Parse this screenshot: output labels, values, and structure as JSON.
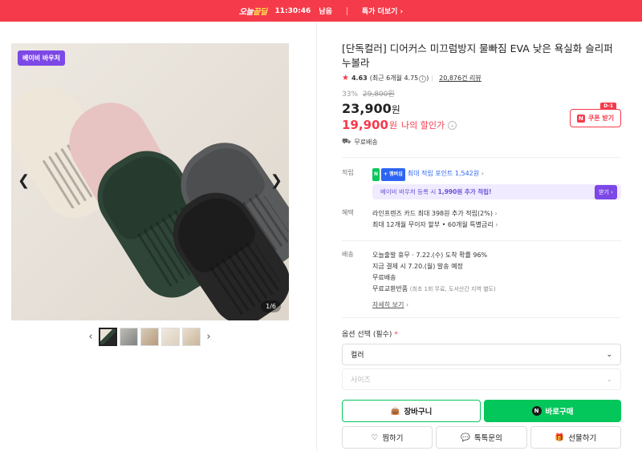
{
  "top_banner": {
    "brand_prefix": "오늘",
    "brand_highlight": "끝딜",
    "countdown": "11:30:46",
    "countdown_suffix": "남음",
    "more_label": "특가 더보기",
    "bg_color": "#f53b4b"
  },
  "gallery": {
    "badge": "베이비 바우처",
    "counter": "1/6",
    "prev_icon": "chevron-left-icon",
    "next_icon": "chevron-right-icon",
    "slipper_colors": [
      "#eee6d8",
      "#e8c4c3",
      "#2f4538",
      "#5a5b5c",
      "#262626"
    ],
    "thumb_count": 5
  },
  "product": {
    "title": "[단독컬러] 디어커스 미끄럼방지 물빠짐 EVA 낮은 욕실화 슬리퍼 누볼라",
    "rating": "4.63",
    "rating_detail": "(최근 6개월 4.75",
    "rating_detail_end": ")",
    "reviews": "20,876건 리뷰",
    "discount": "33%",
    "original_price": "29,800원",
    "price": "23,900",
    "price_unit": "원",
    "my_price": "19,900",
    "my_price_unit": "원",
    "my_price_label": "나의 할인가",
    "coupon_label": "쿠폰 받기",
    "coupon_badge": "D-1",
    "shipping": "무료배송"
  },
  "points": {
    "key": "적립",
    "badge_n": "N",
    "badge_pay": "+ 멤버십",
    "text": "최대 적립 포인트 1,542원",
    "voucher_text_pre": "베이비 바우처 등록 시 ",
    "voucher_amount": "1,990원 추가 적립!",
    "voucher_button": "받기"
  },
  "benefits": {
    "key": "혜택",
    "line1": "라인프렌즈 카드 최대 398원 추가 적립(2%)",
    "line2": "최대 12개월 무이자 할부 • 60개월 특별금리"
  },
  "delivery": {
    "key": "배송",
    "line1": "오늘출발 휴무 · 7.22.(수) 도착 확률 96%",
    "line2": "지금 결제 시 7.20.(월) 발송 예정",
    "line3": "무료배송",
    "line4": "무료교환반품",
    "line4_note": "(최초 1회 무료, 도서산간 지역 별도)",
    "detail_link": "자세히 보기"
  },
  "options": {
    "title": "옵션 선택 (필수)",
    "required_mark": "*",
    "color_select": "컬러",
    "size_select": "사이즈"
  },
  "actions": {
    "cart": "장바구니",
    "buy": "바로구매",
    "wish": "찜하기",
    "talk": "톡톡문의",
    "gift": "선물하기",
    "accent": "#03c75a"
  }
}
